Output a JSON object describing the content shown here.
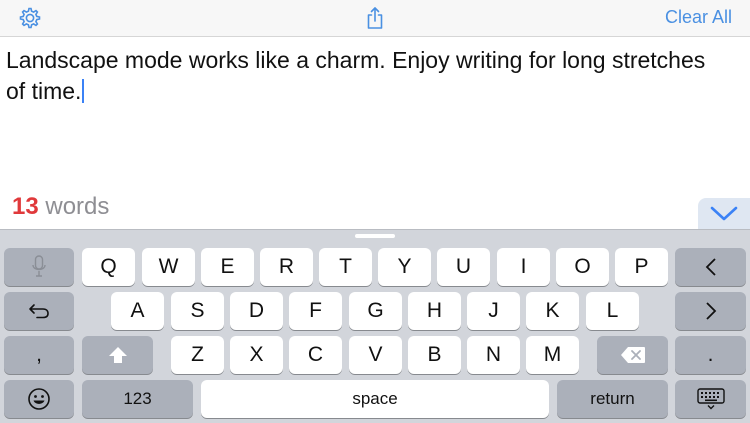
{
  "toolbar": {
    "settings_icon": "gear-icon",
    "share_icon": "share-icon",
    "clear_label": "Clear All",
    "accent_color": "#4a90e2"
  },
  "editor": {
    "text_line1": "Landscape mode works like a charm. Enjoy writing for long stretches",
    "text_line2": "of time."
  },
  "word_count": {
    "number": "13",
    "label": "words",
    "number_color": "#e0393b"
  },
  "keyboard": {
    "row1": [
      "Q",
      "W",
      "E",
      "R",
      "T",
      "Y",
      "U",
      "I",
      "O",
      "P"
    ],
    "row2": [
      "A",
      "S",
      "D",
      "F",
      "G",
      "H",
      "J",
      "K",
      "L"
    ],
    "row3": [
      "Z",
      "X",
      "C",
      "V",
      "B",
      "N",
      "M"
    ],
    "comma": ",",
    "period": ".",
    "numbers_label": "123",
    "space_label": "space",
    "return_label": "return",
    "icons": [
      "microphone-icon",
      "left-arrow-key",
      "undo-icon",
      "right-arrow-key",
      "shift-icon",
      "backspace-icon",
      "emoji-icon",
      "keyboard-hide-icon",
      "chevron-down-icon"
    ]
  }
}
